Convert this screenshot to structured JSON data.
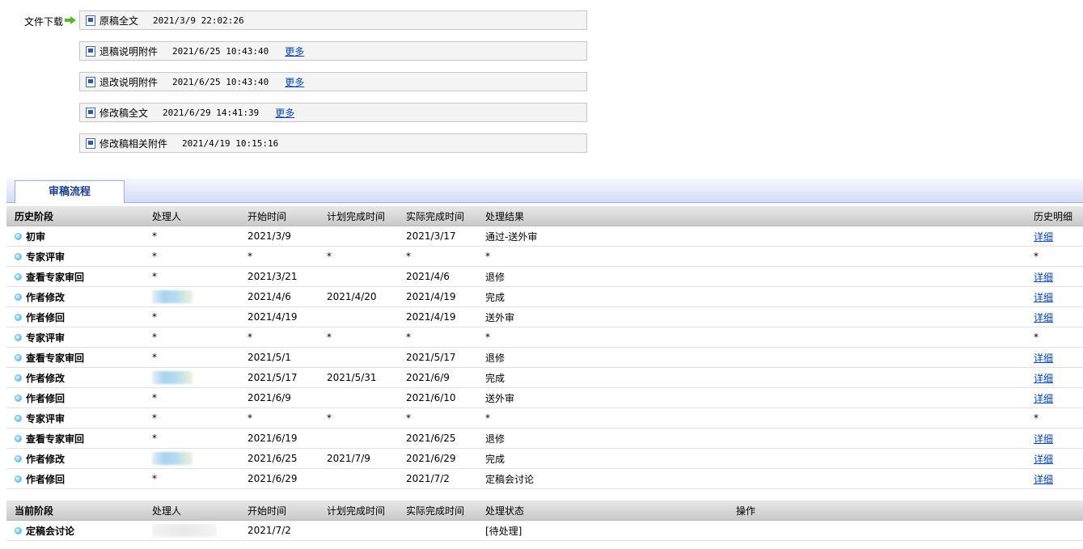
{
  "downloads": {
    "label": "文件下载",
    "files": [
      {
        "name": "原稿全文",
        "time": "2021/3/9 22:02:26",
        "more": ""
      },
      {
        "name": "退稿说明附件",
        "time": "2021/6/25 10:43:40",
        "more": "更多"
      },
      {
        "name": "退改说明附件",
        "time": "2021/6/25 10:43:40",
        "more": "更多"
      },
      {
        "name": "修改稿全文",
        "time": "2021/6/29 14:41:39",
        "more": "更多"
      },
      {
        "name": "修改稿相关附件",
        "time": "2021/4/19 10:15:16",
        "more": ""
      }
    ]
  },
  "tab": {
    "label": "审稿流程"
  },
  "history": {
    "headers": [
      "历史阶段",
      "处理人",
      "开始时间",
      "计划完成时间",
      "实际完成时间",
      "处理结果",
      "历史明细"
    ],
    "rows": [
      {
        "stage": "初审",
        "handler": "*",
        "start": "2021/3/9",
        "plan": "",
        "actual": "2021/3/17",
        "result": "通过-送外审",
        "detail": "详细",
        "blurred": false
      },
      {
        "stage": "专家评审",
        "handler": "*",
        "start": "*",
        "plan": "*",
        "actual": "*",
        "result": "*",
        "detail": "*",
        "blurred": false
      },
      {
        "stage": "查看专家审回",
        "handler": "*",
        "start": "2021/3/21",
        "plan": "",
        "actual": "2021/4/6",
        "result": "退修",
        "detail": "详细",
        "blurred": false
      },
      {
        "stage": "作者修改",
        "handler": "",
        "start": "2021/4/6",
        "plan": "2021/4/20",
        "actual": "2021/4/19",
        "result": "完成",
        "detail": "详细",
        "blurred": true
      },
      {
        "stage": "作者修回",
        "handler": "*",
        "start": "2021/4/19",
        "plan": "",
        "actual": "2021/4/19",
        "result": "送外审",
        "detail": "详细",
        "blurred": false
      },
      {
        "stage": "专家评审",
        "handler": "*",
        "start": "*",
        "plan": "*",
        "actual": "*",
        "result": "*",
        "detail": "*",
        "blurred": false
      },
      {
        "stage": "查看专家审回",
        "handler": "*",
        "start": "2021/5/1",
        "plan": "",
        "actual": "2021/5/17",
        "result": "退修",
        "detail": "详细",
        "blurred": false
      },
      {
        "stage": "作者修改",
        "handler": "",
        "start": "2021/5/17",
        "plan": "2021/5/31",
        "actual": "2021/6/9",
        "result": "完成",
        "detail": "详细",
        "blurred": true
      },
      {
        "stage": "作者修回",
        "handler": "*",
        "start": "2021/6/9",
        "plan": "",
        "actual": "2021/6/10",
        "result": "送外审",
        "detail": "详细",
        "blurred": false
      },
      {
        "stage": "专家评审",
        "handler": "*",
        "start": "*",
        "plan": "*",
        "actual": "*",
        "result": "*",
        "detail": "*",
        "blurred": false
      },
      {
        "stage": "查看专家审回",
        "handler": "*",
        "start": "2021/6/19",
        "plan": "",
        "actual": "2021/6/25",
        "result": "退修",
        "detail": "详细",
        "blurred": false
      },
      {
        "stage": "作者修改",
        "handler": "",
        "start": "2021/6/25",
        "plan": "2021/7/9",
        "actual": "2021/6/29",
        "result": "完成",
        "detail": "详细",
        "blurred": true
      },
      {
        "stage": "作者修回",
        "handler": "*",
        "start": "2021/6/29",
        "plan": "",
        "actual": "2021/7/2",
        "result": "定稿会讨论",
        "detail": "详细",
        "blurred": false
      }
    ]
  },
  "current": {
    "headers": [
      "当前阶段",
      "处理人",
      "开始时间",
      "计划完成时间",
      "实际完成时间",
      "处理状态",
      "操作"
    ],
    "rows": [
      {
        "stage": "定稿会讨论",
        "handler": "",
        "start": "2021/7/2",
        "plan": "",
        "actual": "",
        "status": "[待处理]",
        "op": ""
      }
    ]
  },
  "colors": {
    "link": "#0645ad",
    "tab_text": "#1e3f8a",
    "arrow": "#5cb82a"
  }
}
